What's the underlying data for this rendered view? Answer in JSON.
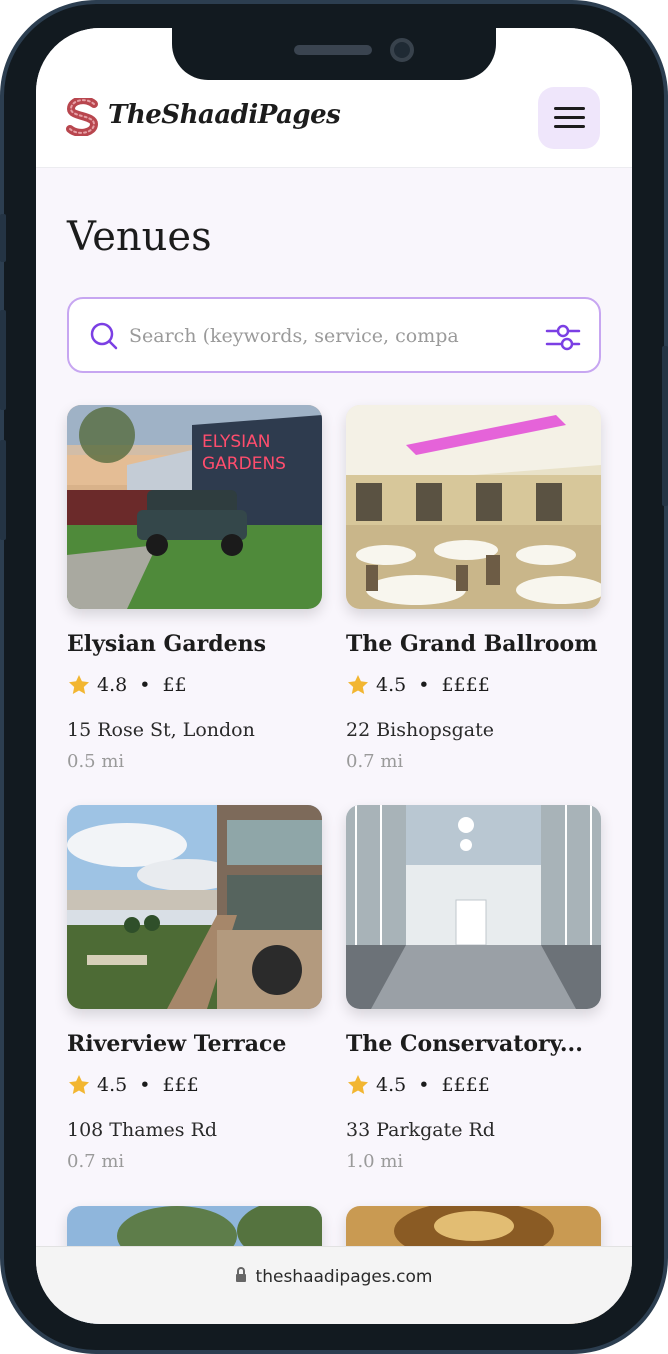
{
  "header": {
    "logo_text": "TheShaadiPages",
    "menu_icon": "hamburger-menu-icon"
  },
  "page": {
    "title": "Venues"
  },
  "search": {
    "placeholder": "Search (keywords, service, company)",
    "value": "",
    "icons": [
      "search-icon",
      "filter-sliders-icon"
    ]
  },
  "venues": [
    {
      "name": "Elysian Gardens",
      "rating": "4.8",
      "price": "££",
      "address": "15 Rose St, London",
      "distance": "0.5 mi"
    },
    {
      "name": "The Grand Ballroom",
      "rating": "4.5",
      "price": "££££",
      "address": "22 Bishopsgate",
      "distance": "0.7 mi"
    },
    {
      "name": "Riverview Terrace",
      "rating": "4.5",
      "price": "£££",
      "address": "108 Thames Rd",
      "distance": "0.7 mi"
    },
    {
      "name": "The Conservatory...",
      "rating": "4.5",
      "price": "££££",
      "address": "33 Parkgate Rd",
      "distance": "1.0 mi"
    }
  ],
  "browser": {
    "url": "theshaadipages.com"
  },
  "colors": {
    "accent": "#7b3fe4",
    "accent_soft": "#efe6fb",
    "star": "#f2b632",
    "logo": "#b8464e",
    "background": "#f9f6fc"
  }
}
